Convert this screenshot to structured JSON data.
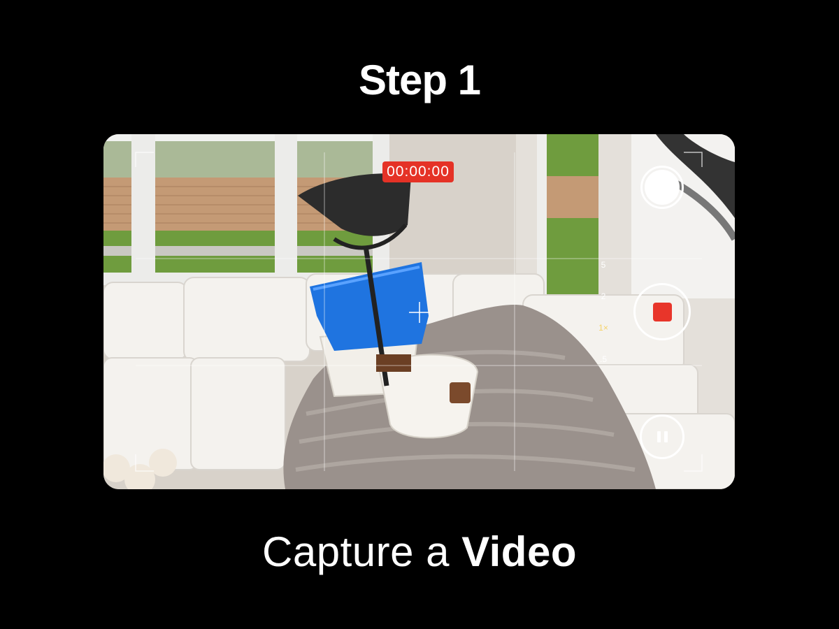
{
  "header": {
    "title": "Step 1"
  },
  "caption": {
    "prefix": "Capture a",
    "emphasis": "Video"
  },
  "camera": {
    "timer": "00:00:00",
    "zoom_levels": [
      {
        "label": "5",
        "active": false
      },
      {
        "label": "2",
        "active": false
      },
      {
        "label": "1×",
        "active": true
      },
      {
        "label": ".5",
        "active": false
      }
    ],
    "colors": {
      "record": "#e8352a",
      "timer_bg": "#e53226",
      "zoom_active": "#f5d36a"
    },
    "icons": {
      "shutter": "shutter-icon",
      "record": "record-stop-icon",
      "pause": "pause-icon",
      "focus": "crosshair-icon"
    }
  }
}
